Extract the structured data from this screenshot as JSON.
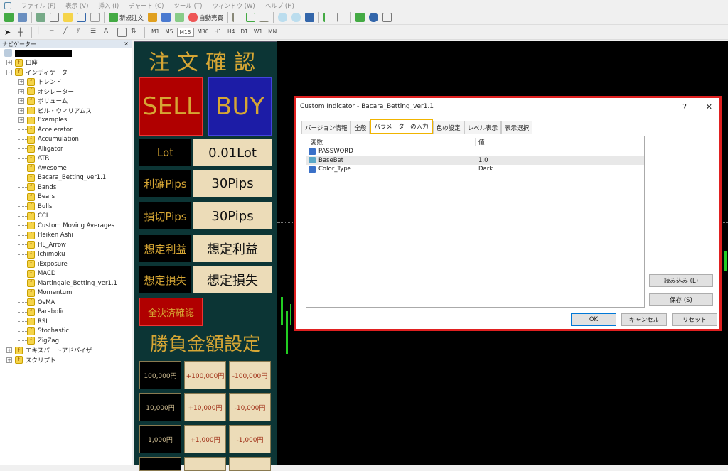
{
  "menu": [
    "ファイル (F)",
    "表示 (V)",
    "挿入 (I)",
    "チャート (C)",
    "ツール (T)",
    "ウィンドウ (W)",
    "ヘルプ (H)"
  ],
  "toolbar": {
    "new_order": "新規注文",
    "auto_trade": "自動売買",
    "timeframes": [
      "M1",
      "M5",
      "M15",
      "M30",
      "H1",
      "H4",
      "D1",
      "W1",
      "MN"
    ],
    "active_timeframe": "M15",
    "draw_text": "A"
  },
  "navigator": {
    "title": "ナビゲーター",
    "close": "×",
    "items": [
      {
        "label": "口座",
        "level": 1,
        "expand": "+"
      },
      {
        "label": "インディケータ",
        "level": 1,
        "expand": "-"
      },
      {
        "label": "トレンド",
        "level": 2,
        "expand": "+"
      },
      {
        "label": "オシレーター",
        "level": 2,
        "expand": "+"
      },
      {
        "label": "ボリューム",
        "level": 2,
        "expand": "+"
      },
      {
        "label": "ビル・ウィリアムス",
        "level": 2,
        "expand": "+"
      },
      {
        "label": "Examples",
        "level": 2,
        "expand": "+"
      },
      {
        "label": "Accelerator",
        "level": 2
      },
      {
        "label": "Accumulation",
        "level": 2
      },
      {
        "label": "Alligator",
        "level": 2
      },
      {
        "label": "ATR",
        "level": 2
      },
      {
        "label": "Awesome",
        "level": 2
      },
      {
        "label": "Bacara_Betting_ver1.1",
        "level": 2
      },
      {
        "label": "Bands",
        "level": 2
      },
      {
        "label": "Bears",
        "level": 2
      },
      {
        "label": "Bulls",
        "level": 2
      },
      {
        "label": "CCI",
        "level": 2
      },
      {
        "label": "Custom Moving Averages",
        "level": 2
      },
      {
        "label": "Heiken Ashi",
        "level": 2
      },
      {
        "label": "HL_Arrow",
        "level": 2
      },
      {
        "label": "Ichimoku",
        "level": 2
      },
      {
        "label": "iExposure",
        "level": 2
      },
      {
        "label": "MACD",
        "level": 2
      },
      {
        "label": "Martingale_Betting_ver1.1",
        "level": 2
      },
      {
        "label": "Momentum",
        "level": 2
      },
      {
        "label": "OsMA",
        "level": 2
      },
      {
        "label": "Parabolic",
        "level": 2
      },
      {
        "label": "RSI",
        "level": 2
      },
      {
        "label": "Stochastic",
        "level": 2
      },
      {
        "label": "ZigZag",
        "level": 2
      },
      {
        "label": "エキスパートアドバイザ",
        "level": 1,
        "expand": "+"
      },
      {
        "label": "スクリプト",
        "level": 1,
        "expand": "+"
      }
    ]
  },
  "panel": {
    "title": "注文確認",
    "sell": "SELL",
    "buy": "BUY",
    "rows": [
      {
        "label": "Lot",
        "value": "0.01Lot"
      },
      {
        "label": "利確Pips",
        "value": "30Pips"
      },
      {
        "label": "損切Pips",
        "value": "30Pips"
      },
      {
        "label": "想定利益",
        "value": "想定利益"
      },
      {
        "label": "想定損失",
        "value": "想定損失"
      }
    ],
    "close_all": "全決済確認",
    "bet_title": "勝負金額設定",
    "bet_grid": [
      [
        "100,000円",
        "+100,000円",
        "-100,000円"
      ],
      [
        "10,000円",
        "+10,000円",
        "-10,000円"
      ],
      [
        "1,000円",
        "+1,000円",
        "-1,000円"
      ]
    ]
  },
  "dialog": {
    "title": "Custom Indicator - Bacara_Betting_ver1.1",
    "help": "?",
    "close": "✕",
    "tabs": [
      "バージョン情報",
      "全般",
      "パラメーターの入力",
      "色の設定",
      "レベル表示",
      "表示選択"
    ],
    "active_tab": "パラメーターの入力",
    "columns": [
      "変数",
      "値"
    ],
    "params": [
      {
        "name": "PASSWORD",
        "value": ""
      },
      {
        "name": "BaseBet",
        "value": "1.0"
      },
      {
        "name": "Color_Type",
        "value": "Dark"
      }
    ],
    "load": "読み込み (L)",
    "save": "保存 (S)",
    "ok": "OK",
    "cancel": "キャンセル",
    "reset": "リセット"
  },
  "colors": {
    "highlight_border": "#e02020",
    "active_tab": "#f0b400",
    "sell": "#b00000",
    "buy": "#1c1ca6",
    "gold": "#d6a634"
  }
}
